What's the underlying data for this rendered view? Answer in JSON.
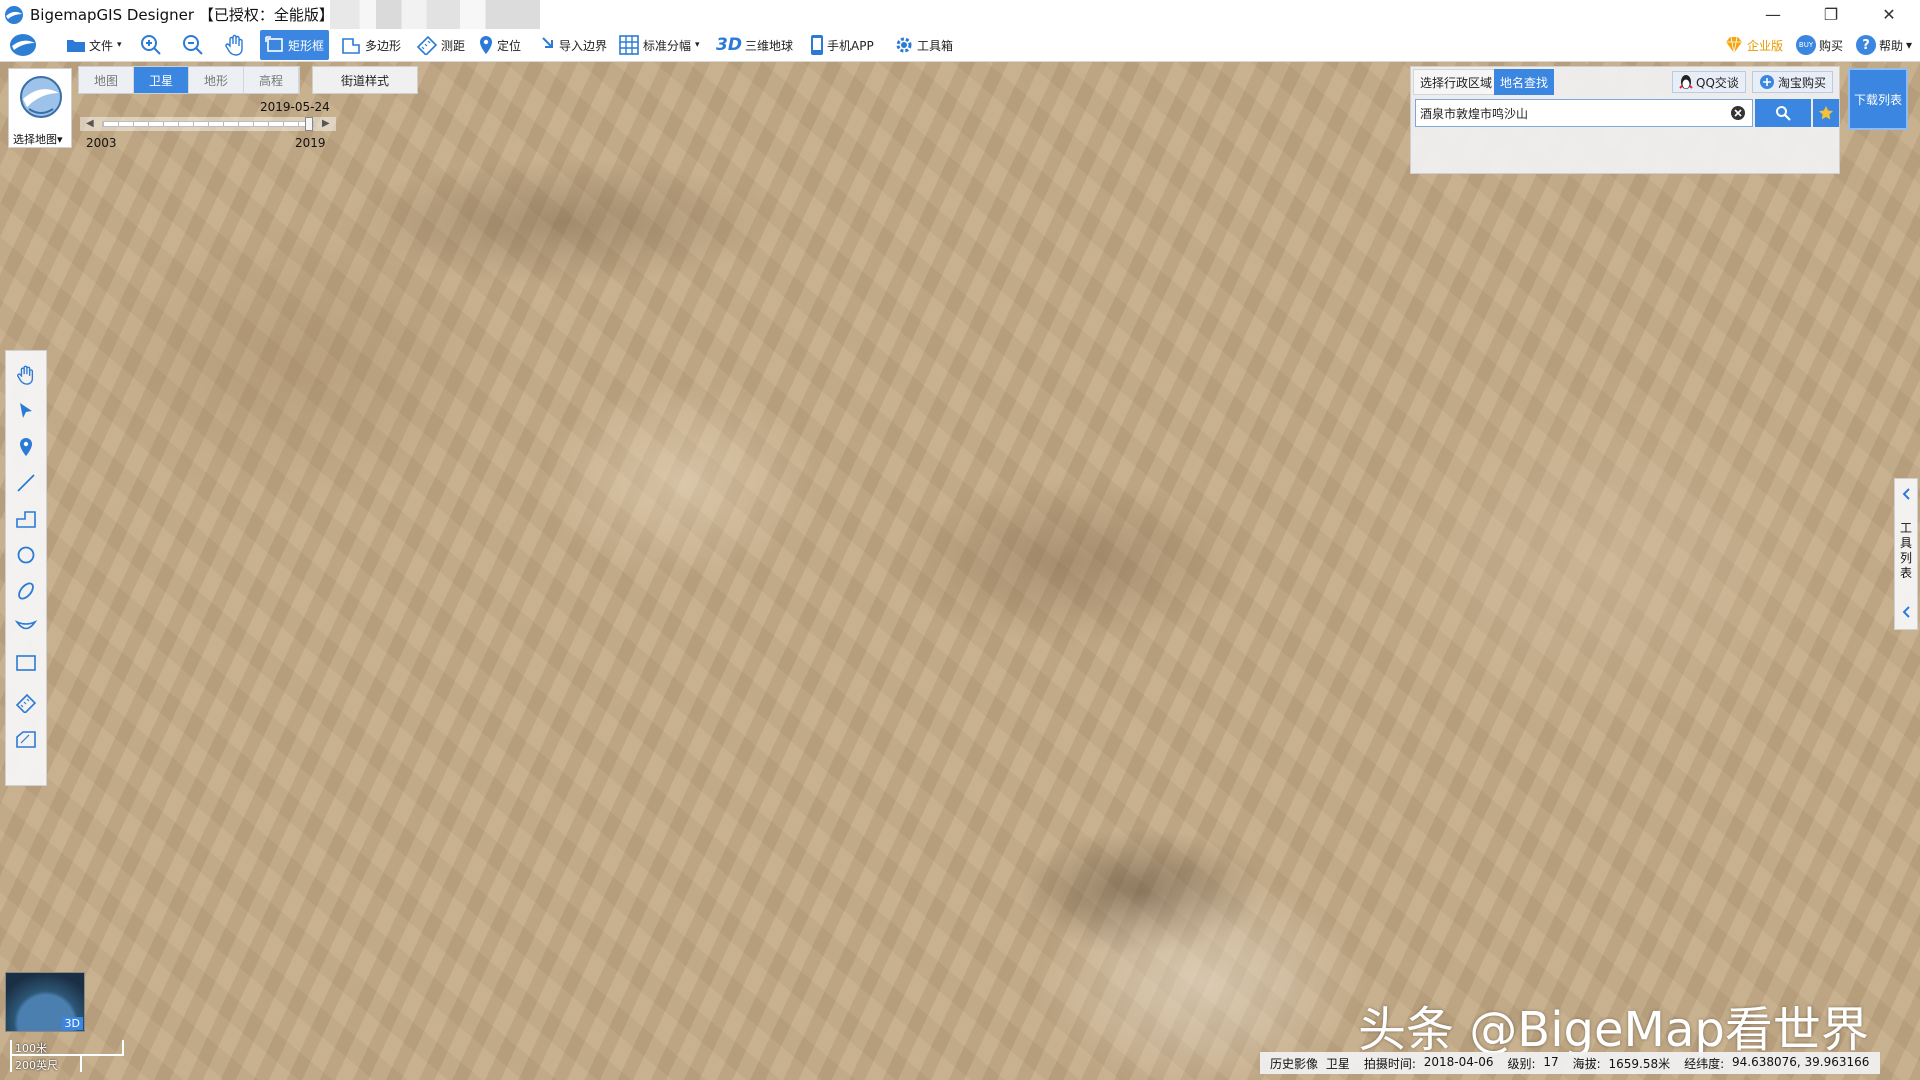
{
  "window": {
    "title": "BigemapGIS Designer 【已授权：全能版】",
    "controls": {
      "minimize": "—",
      "restore": "❐",
      "close": "✕"
    }
  },
  "toolbar": {
    "file": "文件",
    "rect": "矩形框",
    "polygon": "多边形",
    "measure": "测距",
    "locate": "定位",
    "import_border": "导入边界",
    "standard_sheet": "标准分幅",
    "globe_3d_prefix": "3D",
    "globe_3d": "三维地球",
    "mobile_app": "手机APP",
    "toolbox": "工具箱",
    "enterprise": "企业版",
    "buy_badge": "BUY",
    "buy": "购买",
    "help": "帮助"
  },
  "map_panel": {
    "select_map": "选择地图",
    "tabs": [
      {
        "label": "地图",
        "active": false
      },
      {
        "label": "卫星",
        "active": true
      },
      {
        "label": "地形",
        "active": false
      },
      {
        "label": "高程",
        "active": false
      }
    ],
    "street_style": "街道样式"
  },
  "timeline": {
    "current": "2019-05-24",
    "start": "2003",
    "end": "2019",
    "position": 1.0
  },
  "search": {
    "tab_region": "选择行政区域",
    "tab_place": "地名查找",
    "qq_chat": "QQ交谈",
    "taobao": "淘宝购买",
    "query": "酒泉市敦煌市鸣沙山"
  },
  "download_list": "下载列表",
  "tool_list": "工具列表",
  "minimap": {
    "badge": "3D"
  },
  "scale": {
    "metric": "100米",
    "imperial": "200英尺"
  },
  "watermark": "头条 @BigeMap看世界",
  "status": {
    "history": "历史影像",
    "layer": "卫星",
    "capture_label": "拍摄时间:",
    "capture": "2018-04-06",
    "level_label": "级别:",
    "level": "17",
    "altitude_label": "海拔:",
    "altitude": "1659.58米",
    "coords_label": "经纬度:",
    "coords": "94.638076, 39.963166"
  },
  "colors": {
    "accent": "#3a86e0",
    "toolbar_icon": "#2b7bd6"
  }
}
